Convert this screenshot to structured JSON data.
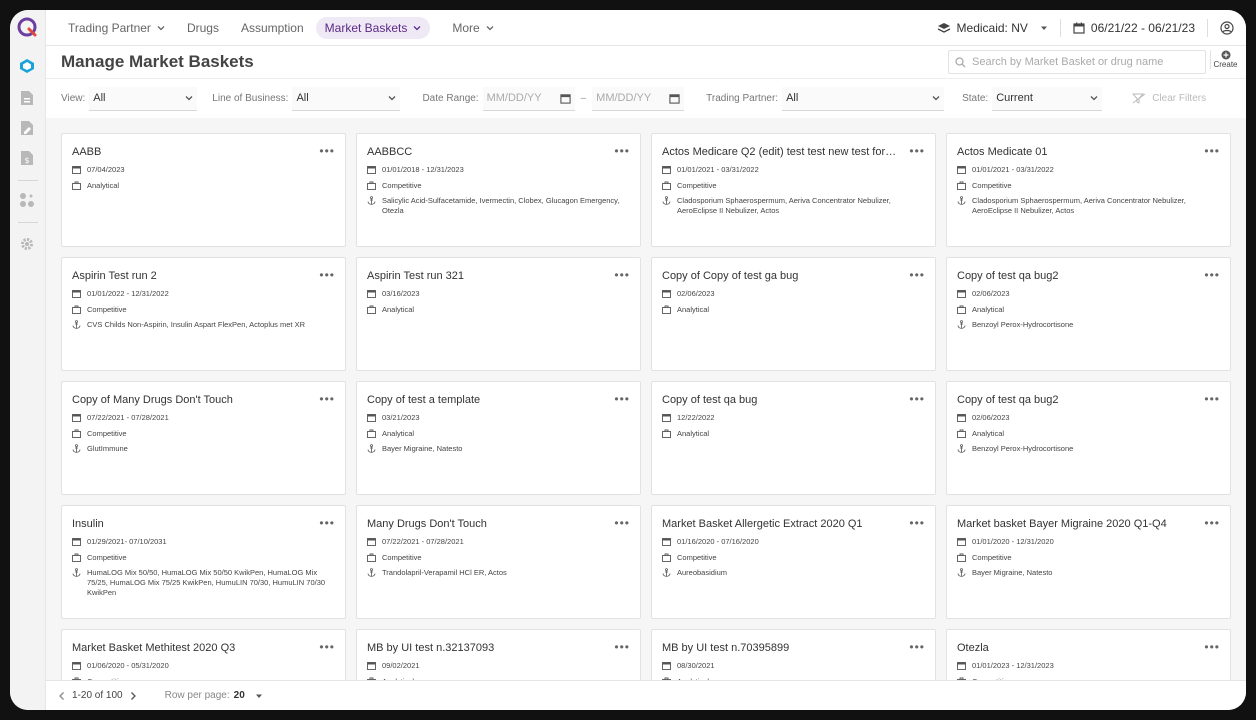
{
  "nav": {
    "items": [
      {
        "label": "Trading Partner",
        "has_chevron": true,
        "active": false
      },
      {
        "label": "Drugs",
        "has_chevron": false,
        "active": false
      },
      {
        "label": "Assumption",
        "has_chevron": false,
        "active": false
      },
      {
        "label": "Market Baskets",
        "has_chevron": true,
        "active": true
      },
      {
        "label": "More",
        "has_chevron": true,
        "active": false
      }
    ],
    "medicaid": "Medicaid: NV",
    "date_range": "06/21/22 - 06/21/23"
  },
  "header": {
    "title": "Manage Market Baskets",
    "search_placeholder": "Search by Market Basket or drug name",
    "create_label": "Create"
  },
  "filters": {
    "view_label": "View:",
    "view_value": "All",
    "lob_label": "Line of Business:",
    "lob_value": "All",
    "date_label": "Date Range:",
    "date_from_placeholder": "MM/DD/YY",
    "date_to_placeholder": "MM/DD/YY",
    "date_sep": "–",
    "tp_label": "Trading Partner:",
    "tp_value": "All",
    "state_label": "State:",
    "state_value": "Current",
    "clear_label": "Clear Filters"
  },
  "cards": [
    {
      "title": "AABB",
      "date": "07/04/2023",
      "type": "Analytical",
      "drugs": ""
    },
    {
      "title": "AABBCC",
      "date": "01/01/2018 - 12/31/2023",
      "type": "Competitive",
      "drugs": "Salicylic Acid-Sulfacetamide, Ivermectin, Clobex, Glucagon Emergency, Otezla"
    },
    {
      "title": "Actos Medicare Q2 (edit) test test new test for t ...",
      "date": "01/01/2021 - 03/31/2022",
      "type": "Competitive",
      "drugs": "Cladosporium Sphaerospermum, Aeriva Concentrator Nebulizer, AeroEclipse II Nebulizer, Actos"
    },
    {
      "title": "Actos Medicate 01",
      "date": "01/01/2021 - 03/31/2022",
      "type": "Competitive",
      "drugs": "Cladosporium Sphaerospermum, Aeriva Concentrator Nebulizer, AeroEclipse II Nebulizer, Actos"
    },
    {
      "title": "Aspirin Test run 2",
      "date": "01/01/2022 - 12/31/2022",
      "type": "Competitive",
      "drugs": "CVS Childs Non-Aspirin, Insulin Aspart FlexPen, Actoplus met XR"
    },
    {
      "title": "Aspirin Test run 321",
      "date": "03/16/2023",
      "type": "Analytical",
      "drugs": ""
    },
    {
      "title": "Copy of Copy of test ga bug",
      "date": "02/06/2023",
      "type": "Analytical",
      "drugs": ""
    },
    {
      "title": "Copy of test qa bug2",
      "date": "02/06/2023",
      "type": "Analytical",
      "drugs": "Benzoyl Perox-Hydrocortisone"
    },
    {
      "title": "Copy of Many Drugs Don't Touch",
      "date": "07/22/2021 - 07/28/2021",
      "type": "Competitive",
      "drugs": "GlutImmune"
    },
    {
      "title": "Copy of test a template",
      "date": "03/21/2023",
      "type": "Analytical",
      "drugs": "Bayer Migraine, Natesto"
    },
    {
      "title": "Copy of test qa bug",
      "date": "12/22/2022",
      "type": "Analytical",
      "drugs": ""
    },
    {
      "title": "Copy of test qa bug2",
      "date": "02/06/2023",
      "type": "Analytical",
      "drugs": "Benzoyl Perox-Hydrocortisone"
    },
    {
      "title": "Insulin",
      "date": "01/29/2021- 07/10/2031",
      "type": "Competitive",
      "drugs": "HumaLOG Mix 50/50, HumaLOG Mix 50/50 KwikPen, HumaLOG Mix 75/25, HumaLOG Mix 75/25 KwikPen, HumuLIN 70/30, HumuLIN 70/30 KwikPen"
    },
    {
      "title": "Many Drugs Don't Touch",
      "date": "07/22/2021 - 07/28/2021",
      "type": "Competitive",
      "drugs": "Trandolapril-Verapamil HCl ER, Actos"
    },
    {
      "title": "Market Basket Allergetic Extract 2020 Q1",
      "date": "01/16/2020 - 07/16/2020",
      "type": "Competitive",
      "drugs": "Aureobasidium"
    },
    {
      "title": "Market basket Bayer Migraine 2020 Q1-Q4",
      "date": "01/01/2020 - 12/31/2020",
      "type": "Competitive",
      "drugs": "Bayer Migraine, Natesto"
    },
    {
      "title": "Market Basket Methitest 2020 Q3",
      "date": "01/06/2020 - 05/31/2020",
      "type": "Competitive",
      "drugs": ""
    },
    {
      "title": "MB by UI test n.32137093",
      "date": "09/02/2021",
      "type": "Analytical",
      "drugs": ""
    },
    {
      "title": "MB by UI test n.70395899",
      "date": "08/30/2021",
      "type": "Analytical",
      "drugs": ""
    },
    {
      "title": "Otezla",
      "date": "01/01/2023 - 12/31/2023",
      "type": "Competitive",
      "drugs": ""
    }
  ],
  "footer": {
    "range": "1-20 of 100",
    "rows_label": "Row per page:",
    "rows_value": "20"
  },
  "colors": {
    "accent": "#5b2a86",
    "active_bg": "#efe9f6",
    "rail_active": "#1aa3d9"
  }
}
